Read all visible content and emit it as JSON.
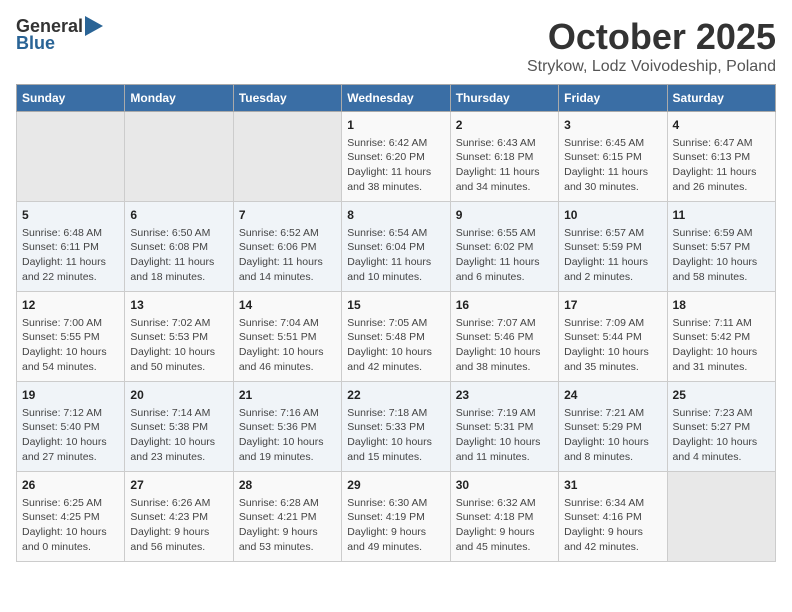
{
  "header": {
    "logo_general": "General",
    "logo_blue": "Blue",
    "month_title": "October 2025",
    "location": "Strykow, Lodz Voivodeship, Poland"
  },
  "weekdays": [
    "Sunday",
    "Monday",
    "Tuesday",
    "Wednesday",
    "Thursday",
    "Friday",
    "Saturday"
  ],
  "weeks": [
    [
      {
        "day": "",
        "info": ""
      },
      {
        "day": "",
        "info": ""
      },
      {
        "day": "",
        "info": ""
      },
      {
        "day": "1",
        "info": "Sunrise: 6:42 AM\nSunset: 6:20 PM\nDaylight: 11 hours\nand 38 minutes."
      },
      {
        "day": "2",
        "info": "Sunrise: 6:43 AM\nSunset: 6:18 PM\nDaylight: 11 hours\nand 34 minutes."
      },
      {
        "day": "3",
        "info": "Sunrise: 6:45 AM\nSunset: 6:15 PM\nDaylight: 11 hours\nand 30 minutes."
      },
      {
        "day": "4",
        "info": "Sunrise: 6:47 AM\nSunset: 6:13 PM\nDaylight: 11 hours\nand 26 minutes."
      }
    ],
    [
      {
        "day": "5",
        "info": "Sunrise: 6:48 AM\nSunset: 6:11 PM\nDaylight: 11 hours\nand 22 minutes."
      },
      {
        "day": "6",
        "info": "Sunrise: 6:50 AM\nSunset: 6:08 PM\nDaylight: 11 hours\nand 18 minutes."
      },
      {
        "day": "7",
        "info": "Sunrise: 6:52 AM\nSunset: 6:06 PM\nDaylight: 11 hours\nand 14 minutes."
      },
      {
        "day": "8",
        "info": "Sunrise: 6:54 AM\nSunset: 6:04 PM\nDaylight: 11 hours\nand 10 minutes."
      },
      {
        "day": "9",
        "info": "Sunrise: 6:55 AM\nSunset: 6:02 PM\nDaylight: 11 hours\nand 6 minutes."
      },
      {
        "day": "10",
        "info": "Sunrise: 6:57 AM\nSunset: 5:59 PM\nDaylight: 11 hours\nand 2 minutes."
      },
      {
        "day": "11",
        "info": "Sunrise: 6:59 AM\nSunset: 5:57 PM\nDaylight: 10 hours\nand 58 minutes."
      }
    ],
    [
      {
        "day": "12",
        "info": "Sunrise: 7:00 AM\nSunset: 5:55 PM\nDaylight: 10 hours\nand 54 minutes."
      },
      {
        "day": "13",
        "info": "Sunrise: 7:02 AM\nSunset: 5:53 PM\nDaylight: 10 hours\nand 50 minutes."
      },
      {
        "day": "14",
        "info": "Sunrise: 7:04 AM\nSunset: 5:51 PM\nDaylight: 10 hours\nand 46 minutes."
      },
      {
        "day": "15",
        "info": "Sunrise: 7:05 AM\nSunset: 5:48 PM\nDaylight: 10 hours\nand 42 minutes."
      },
      {
        "day": "16",
        "info": "Sunrise: 7:07 AM\nSunset: 5:46 PM\nDaylight: 10 hours\nand 38 minutes."
      },
      {
        "day": "17",
        "info": "Sunrise: 7:09 AM\nSunset: 5:44 PM\nDaylight: 10 hours\nand 35 minutes."
      },
      {
        "day": "18",
        "info": "Sunrise: 7:11 AM\nSunset: 5:42 PM\nDaylight: 10 hours\nand 31 minutes."
      }
    ],
    [
      {
        "day": "19",
        "info": "Sunrise: 7:12 AM\nSunset: 5:40 PM\nDaylight: 10 hours\nand 27 minutes."
      },
      {
        "day": "20",
        "info": "Sunrise: 7:14 AM\nSunset: 5:38 PM\nDaylight: 10 hours\nand 23 minutes."
      },
      {
        "day": "21",
        "info": "Sunrise: 7:16 AM\nSunset: 5:36 PM\nDaylight: 10 hours\nand 19 minutes."
      },
      {
        "day": "22",
        "info": "Sunrise: 7:18 AM\nSunset: 5:33 PM\nDaylight: 10 hours\nand 15 minutes."
      },
      {
        "day": "23",
        "info": "Sunrise: 7:19 AM\nSunset: 5:31 PM\nDaylight: 10 hours\nand 11 minutes."
      },
      {
        "day": "24",
        "info": "Sunrise: 7:21 AM\nSunset: 5:29 PM\nDaylight: 10 hours\nand 8 minutes."
      },
      {
        "day": "25",
        "info": "Sunrise: 7:23 AM\nSunset: 5:27 PM\nDaylight: 10 hours\nand 4 minutes."
      }
    ],
    [
      {
        "day": "26",
        "info": "Sunrise: 6:25 AM\nSunset: 4:25 PM\nDaylight: 10 hours\nand 0 minutes."
      },
      {
        "day": "27",
        "info": "Sunrise: 6:26 AM\nSunset: 4:23 PM\nDaylight: 9 hours\nand 56 minutes."
      },
      {
        "day": "28",
        "info": "Sunrise: 6:28 AM\nSunset: 4:21 PM\nDaylight: 9 hours\nand 53 minutes."
      },
      {
        "day": "29",
        "info": "Sunrise: 6:30 AM\nSunset: 4:19 PM\nDaylight: 9 hours\nand 49 minutes."
      },
      {
        "day": "30",
        "info": "Sunrise: 6:32 AM\nSunset: 4:18 PM\nDaylight: 9 hours\nand 45 minutes."
      },
      {
        "day": "31",
        "info": "Sunrise: 6:34 AM\nSunset: 4:16 PM\nDaylight: 9 hours\nand 42 minutes."
      },
      {
        "day": "",
        "info": ""
      }
    ]
  ]
}
